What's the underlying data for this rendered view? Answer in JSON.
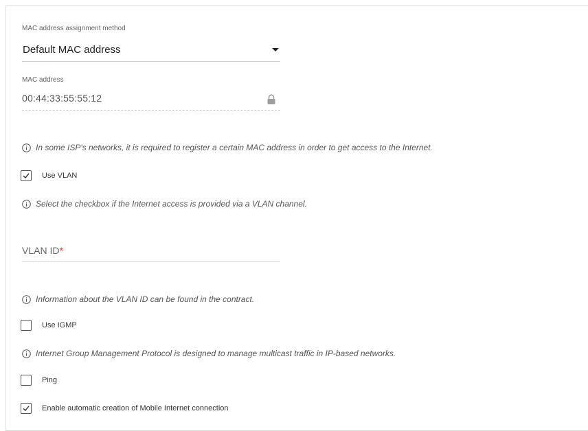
{
  "mac_method": {
    "label": "MAC address assignment method",
    "value": "Default MAC address"
  },
  "mac_address": {
    "label": "MAC address",
    "value": "00:44:33:55:55:12"
  },
  "hints": {
    "mac": "In some ISP's networks, it is required to register a certain MAC address in order to get access to the Internet.",
    "vlan": "Select the checkbox if the Internet access is provided via a VLAN channel.",
    "vlan_id": "Information about the VLAN ID can be found in the contract.",
    "igmp": "Internet Group Management Protocol is designed to manage multicast traffic in IP-based networks."
  },
  "vlan_id": {
    "placeholder": "VLAN ID",
    "required_mark": "*",
    "value": ""
  },
  "checkboxes": {
    "use_vlan": {
      "label": "Use VLAN",
      "checked": true
    },
    "use_igmp": {
      "label": "Use IGMP",
      "checked": false
    },
    "ping": {
      "label": "Ping",
      "checked": false
    },
    "mobile_auto": {
      "label": "Enable automatic creation of Mobile Internet connection",
      "checked": true
    }
  },
  "icons": {
    "info": "info-circle-icon",
    "lock": "lock-icon",
    "caret": "caret-down-icon",
    "check": "checkmark-icon"
  },
  "colors": {
    "text": "#333333",
    "muted": "#666666",
    "required": "#e0302a",
    "border": "#d0d0d0"
  }
}
